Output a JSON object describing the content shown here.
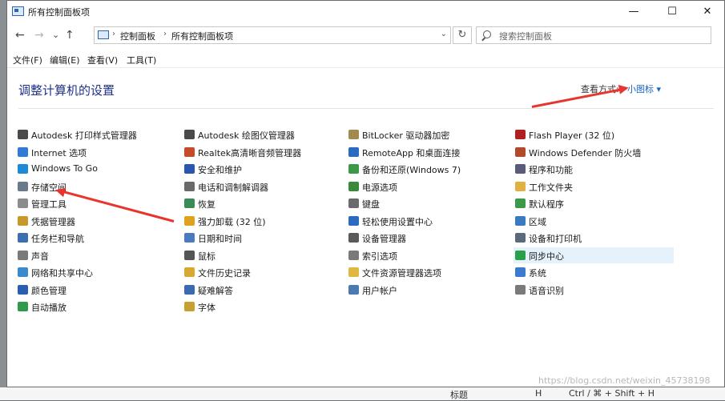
{
  "window": {
    "title": "所有控制面板项",
    "controls": {
      "minimize": "—",
      "maximize": "☐",
      "close": "✕"
    }
  },
  "nav": {
    "back": "←",
    "forward": "→",
    "recent": "⌄",
    "up": "↑",
    "refresh": "↻"
  },
  "address": {
    "crumbs": [
      "控制面板",
      "所有控制面板项"
    ]
  },
  "search": {
    "placeholder": "搜索控制面板"
  },
  "menu": [
    "文件(F)",
    "编辑(E)",
    "查看(V)",
    "工具(T)"
  ],
  "header": {
    "title": "调整计算机的设置",
    "view_by_label": "查看方式:",
    "view_by_value": "小图标 ▾"
  },
  "columns": [
    [
      {
        "label": "Autodesk 打印样式管理器",
        "icon": "printer-style-icon",
        "color": "#4a4a4a"
      },
      {
        "label": "Internet 选项",
        "icon": "internet-options-icon",
        "color": "#2f7bd6"
      },
      {
        "label": "Windows To Go",
        "icon": "windows-to-go-icon",
        "color": "#1b8ad8"
      },
      {
        "label": "存储空间",
        "icon": "storage-spaces-icon",
        "color": "#6b7a8a"
      },
      {
        "label": "管理工具",
        "icon": "admin-tools-icon",
        "color": "#8c8c8c"
      },
      {
        "label": "凭据管理器",
        "icon": "credential-manager-icon",
        "color": "#c8982a"
      },
      {
        "label": "任务栏和导航",
        "icon": "taskbar-icon",
        "color": "#3c6fb0"
      },
      {
        "label": "声音",
        "icon": "sound-icon",
        "color": "#7a7a7a"
      },
      {
        "label": "网络和共享中心",
        "icon": "network-icon",
        "color": "#3a8ad0"
      },
      {
        "label": "颜色管理",
        "icon": "color-management-icon",
        "color": "#2a5fb0"
      },
      {
        "label": "自动播放",
        "icon": "autoplay-icon",
        "color": "#2f9a4a"
      }
    ],
    [
      {
        "label": "Autodesk 绘图仪管理器",
        "icon": "plotter-icon",
        "color": "#4a4a4a"
      },
      {
        "label": "Realtek高清晰音频管理器",
        "icon": "realtek-audio-icon",
        "color": "#c84a2a"
      },
      {
        "label": "安全和维护",
        "icon": "flag-icon",
        "color": "#2a55b0"
      },
      {
        "label": "电话和调制解调器",
        "icon": "phone-modem-icon",
        "color": "#6a6a6a"
      },
      {
        "label": "恢复",
        "icon": "recovery-icon",
        "color": "#3a8a5a"
      },
      {
        "label": "强力卸载 (32 位)",
        "icon": "uninstall-icon",
        "color": "#e0a020"
      },
      {
        "label": "日期和时间",
        "icon": "calendar-icon",
        "color": "#4a7ac0"
      },
      {
        "label": "鼠标",
        "icon": "mouse-icon",
        "color": "#555555"
      },
      {
        "label": "文件历史记录",
        "icon": "file-history-icon",
        "color": "#d8a830"
      },
      {
        "label": "疑难解答",
        "icon": "troubleshoot-icon",
        "color": "#3a6ab0"
      },
      {
        "label": "字体",
        "icon": "fonts-icon",
        "color": "#c8a030"
      }
    ],
    [
      {
        "label": "BitLocker 驱动器加密",
        "icon": "bitlocker-icon",
        "color": "#a08a50"
      },
      {
        "label": "RemoteApp 和桌面连接",
        "icon": "remoteapp-icon",
        "color": "#2a6ac0"
      },
      {
        "label": "备份和还原(Windows 7)",
        "icon": "backup-icon",
        "color": "#3a9a4a"
      },
      {
        "label": "电源选项",
        "icon": "power-options-icon",
        "color": "#3a8a3a"
      },
      {
        "label": "键盘",
        "icon": "keyboard-icon",
        "color": "#6a6a6a"
      },
      {
        "label": "轻松使用设置中心",
        "icon": "ease-of-access-icon",
        "color": "#2a6ac0"
      },
      {
        "label": "设备管理器",
        "icon": "device-manager-icon",
        "color": "#5a5a5a"
      },
      {
        "label": "索引选项",
        "icon": "indexing-icon",
        "color": "#7a7a7a"
      },
      {
        "label": "文件资源管理器选项",
        "icon": "folder-options-icon",
        "color": "#e0b840"
      },
      {
        "label": "用户帐户",
        "icon": "user-accounts-icon",
        "color": "#4a7ab0"
      }
    ],
    [
      {
        "label": "Flash Player (32 位)",
        "icon": "flash-player-icon",
        "color": "#b02020"
      },
      {
        "label": "Windows Defender 防火墙",
        "icon": "firewall-icon",
        "color": "#b04a2a"
      },
      {
        "label": "程序和功能",
        "icon": "programs-icon",
        "color": "#5a5a7a"
      },
      {
        "label": "工作文件夹",
        "icon": "work-folders-icon",
        "color": "#e0b040"
      },
      {
        "label": "默认程序",
        "icon": "default-programs-icon",
        "color": "#3a9a4a"
      },
      {
        "label": "区域",
        "icon": "region-icon",
        "color": "#3a7ac0"
      },
      {
        "label": "设备和打印机",
        "icon": "devices-printers-icon",
        "color": "#5a6a7a"
      },
      {
        "label": "同步中心",
        "icon": "sync-center-icon",
        "color": "#2aa04a"
      },
      {
        "label": "系统",
        "icon": "system-icon",
        "color": "#3a7ad0"
      },
      {
        "label": "语音识别",
        "icon": "speech-recognition-icon",
        "color": "#7a7a7a"
      }
    ]
  ],
  "selected_item": "同步中心",
  "background": {
    "bottom_text": [
      "标题",
      "H",
      "Ctrl / ⌘ + Shift + H"
    ]
  },
  "watermark": "https://blog.csdn.net/weixin_45738198",
  "colors": {
    "link": "#1a64c8",
    "header": "#1e3287",
    "selected": "#e5f1fb",
    "arrow": "#e8362f"
  }
}
